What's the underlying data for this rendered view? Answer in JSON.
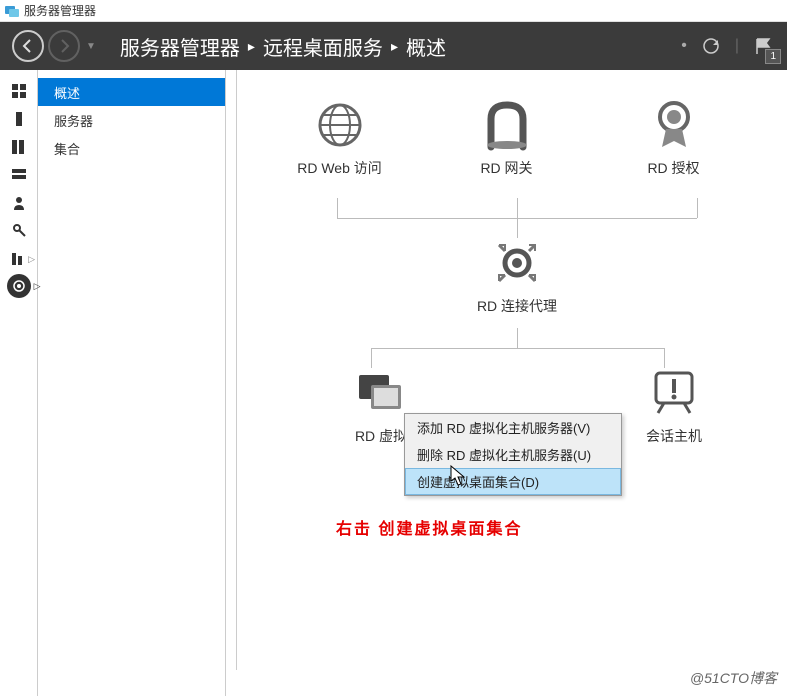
{
  "titlebar": {
    "title": "服务器管理器"
  },
  "breadcrumb": {
    "root": "服务器管理器",
    "l1": "远程桌面服务",
    "l2": "概述"
  },
  "header": {
    "notif_count": "1"
  },
  "sidebar": {
    "items": [
      {
        "label": "概述",
        "active": true
      },
      {
        "label": "服务器",
        "active": false
      },
      {
        "label": "集合",
        "active": false
      }
    ]
  },
  "nodes": {
    "rdweb": "RD Web 访问",
    "rdgateway": "RD 网关",
    "rdlicense": "RD 授权",
    "rdbroker": "RD 连接代理",
    "rdvh_truncated": "RD 虚拟",
    "rdsh": "会话主机"
  },
  "context_menu": {
    "items": [
      "添加 RD 虚拟化主机服务器(V)",
      "删除 RD 虚拟化主机服务器(U)",
      "创建虚拟桌面集合(D)"
    ],
    "highlighted_index": 2
  },
  "annotation": "右击  创建虚拟桌面集合",
  "watermark": "@51CTO博客"
}
